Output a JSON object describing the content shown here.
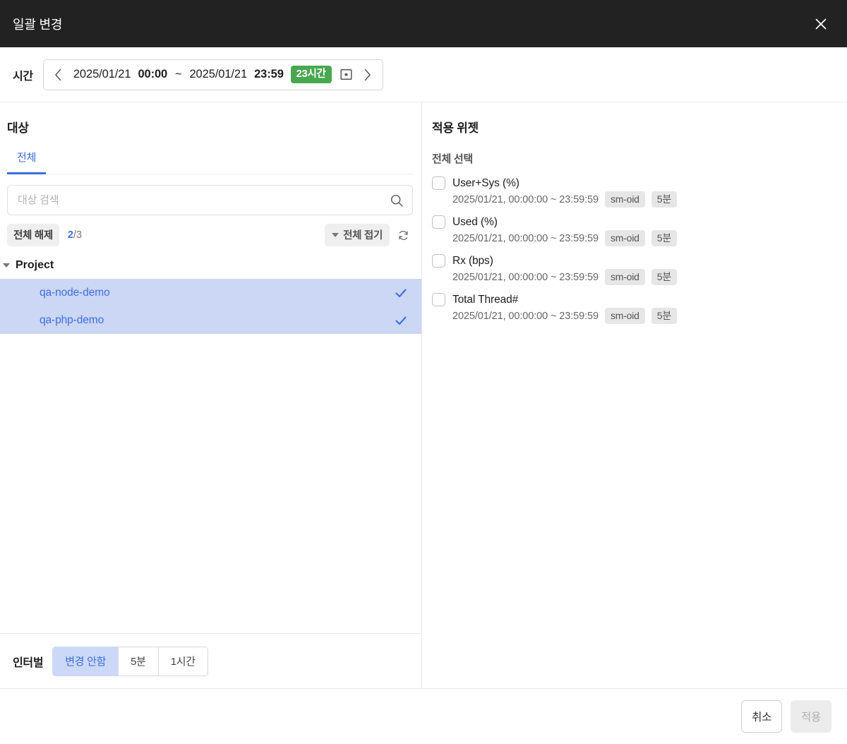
{
  "titlebar": {
    "title": "일괄 변경",
    "close_icon": "close-icon"
  },
  "time": {
    "label": "시간",
    "prev_icon": "chevron-left-icon",
    "next_icon": "chevron-right-icon",
    "start_date": "2025/01/21",
    "start_time": "00:00",
    "separator": "~",
    "end_date": "2025/01/21",
    "end_time": "23:59",
    "duration_badge": "23시간",
    "duration_badge_color": "#48a84f",
    "calendar_icon": "calendar-icon"
  },
  "target": {
    "heading": "대상",
    "tabs": [
      {
        "label": "전체",
        "active": true
      }
    ],
    "search": {
      "value": "",
      "placeholder": "대상 검색",
      "icon": "search-icon"
    },
    "toolbar": {
      "deselect_all": "전체 해제",
      "selected_count": "2",
      "total_count": "/3",
      "collapse_all": "전체 접기",
      "refresh_icon": "refresh-icon"
    },
    "tree": {
      "group_label": "Project",
      "group_expanded": true,
      "items": [
        {
          "label": "qa-node-demo",
          "selected": true
        },
        {
          "label": "qa-php-demo",
          "selected": true
        }
      ]
    }
  },
  "interval": {
    "label": "인터벌",
    "options": [
      {
        "label": "변경 안함",
        "active": true
      },
      {
        "label": "5분",
        "active": false
      },
      {
        "label": "1시간",
        "active": false
      }
    ]
  },
  "widgets": {
    "heading": "적용 위젯",
    "select_all_label": "전체 선택",
    "items": [
      {
        "title": "User+Sys (%)",
        "range": "2025/01/21, 00:00:00 ~ 23:59:59",
        "tag_source": "sm-oid",
        "tag_interval": "5분",
        "checked": false
      },
      {
        "title": "Used (%)",
        "range": "2025/01/21, 00:00:00 ~ 23:59:59",
        "tag_source": "sm-oid",
        "tag_interval": "5분",
        "checked": false
      },
      {
        "title": "Rx (bps)",
        "range": "2025/01/21, 00:00:00 ~ 23:59:59",
        "tag_source": "sm-oid",
        "tag_interval": "5분",
        "checked": false
      },
      {
        "title": "Total Thread#",
        "range": "2025/01/21, 00:00:00 ~ 23:59:59",
        "tag_source": "sm-oid",
        "tag_interval": "5분",
        "checked": false
      }
    ]
  },
  "footer": {
    "cancel_label": "취소",
    "apply_label": "적용",
    "apply_disabled": true
  },
  "colors": {
    "accent_blue": "#3c6ee0",
    "selection_blue": "#ccd6f5",
    "badge_green": "#48a84f",
    "titlebar_bg": "#222222"
  }
}
